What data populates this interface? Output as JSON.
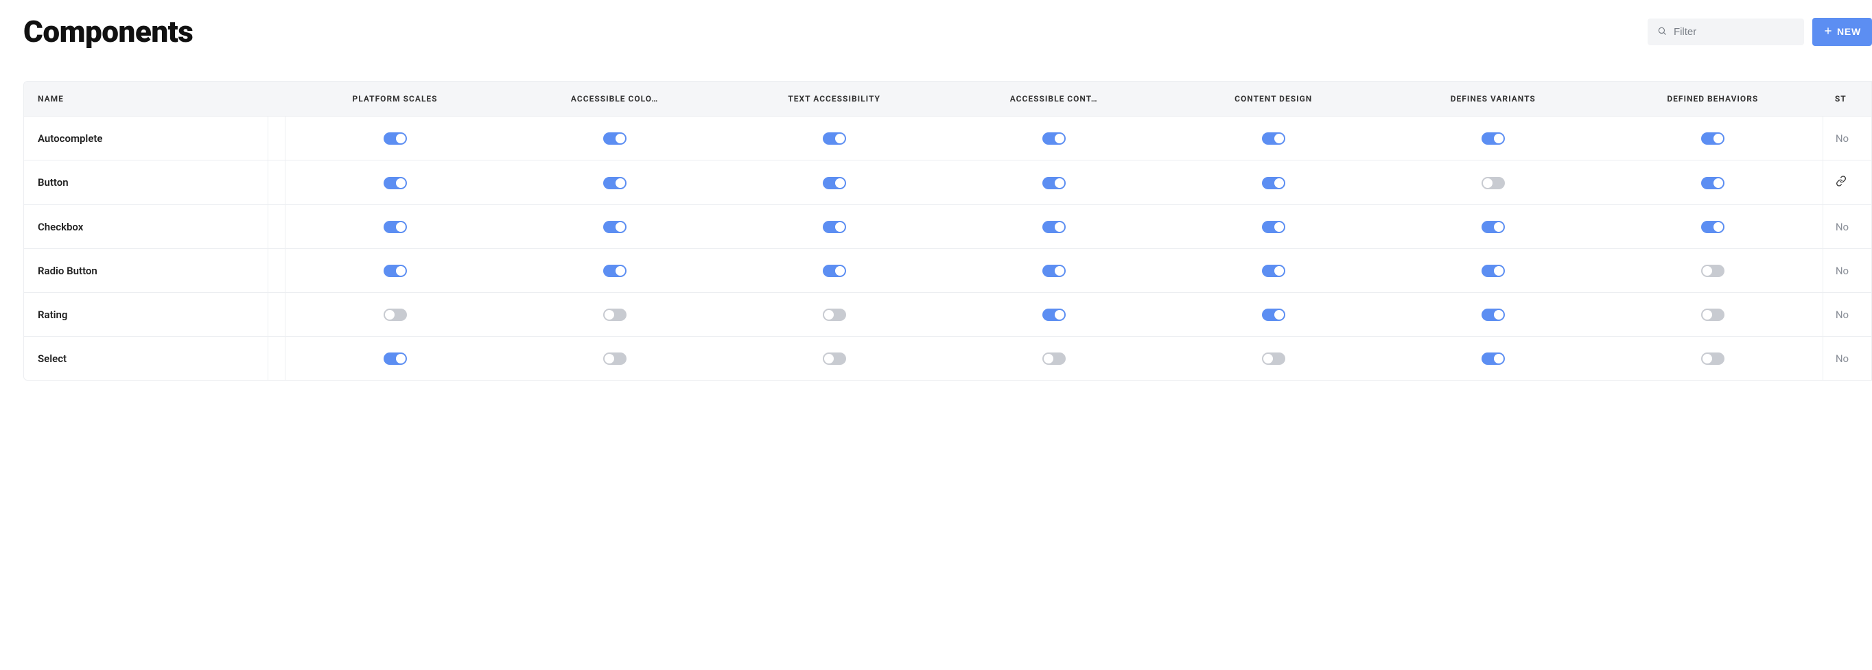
{
  "header": {
    "title": "Components",
    "filter_placeholder": "Filter",
    "new_label": "NEW"
  },
  "columns": [
    "NAME",
    "PLATFORM SCALES",
    "ACCESSIBLE COLO…",
    "TEXT ACCESSIBILITY",
    "ACCESSIBLE CONT…",
    "CONTENT DESIGN",
    "DEFINES VARIANTS",
    "DEFINED BEHAVIORS",
    "ST"
  ],
  "toggle_keys": [
    "platform_scales",
    "accessible_color",
    "text_accessibility",
    "accessible_content",
    "content_design",
    "defines_variants",
    "defined_behaviors"
  ],
  "rows": [
    {
      "name": "Autocomplete",
      "platform_scales": true,
      "accessible_color": true,
      "text_accessibility": true,
      "accessible_content": true,
      "content_design": true,
      "defines_variants": true,
      "defined_behaviors": true,
      "status_display": "No",
      "status_is_link": false
    },
    {
      "name": "Button",
      "platform_scales": true,
      "accessible_color": true,
      "text_accessibility": true,
      "accessible_content": true,
      "content_design": true,
      "defines_variants": false,
      "defined_behaviors": true,
      "status_display": "",
      "status_is_link": true
    },
    {
      "name": "Checkbox",
      "platform_scales": true,
      "accessible_color": true,
      "text_accessibility": true,
      "accessible_content": true,
      "content_design": true,
      "defines_variants": true,
      "defined_behaviors": true,
      "status_display": "No",
      "status_is_link": false
    },
    {
      "name": "Radio Button",
      "platform_scales": true,
      "accessible_color": true,
      "text_accessibility": true,
      "accessible_content": true,
      "content_design": true,
      "defines_variants": true,
      "defined_behaviors": false,
      "status_display": "No",
      "status_is_link": false
    },
    {
      "name": "Rating",
      "platform_scales": false,
      "accessible_color": false,
      "text_accessibility": false,
      "accessible_content": true,
      "content_design": true,
      "defines_variants": true,
      "defined_behaviors": false,
      "status_display": "No",
      "status_is_link": false
    },
    {
      "name": "Select",
      "platform_scales": true,
      "accessible_color": false,
      "text_accessibility": false,
      "accessible_content": false,
      "content_design": false,
      "defines_variants": true,
      "defined_behaviors": false,
      "status_display": "No",
      "status_is_link": false
    }
  ]
}
